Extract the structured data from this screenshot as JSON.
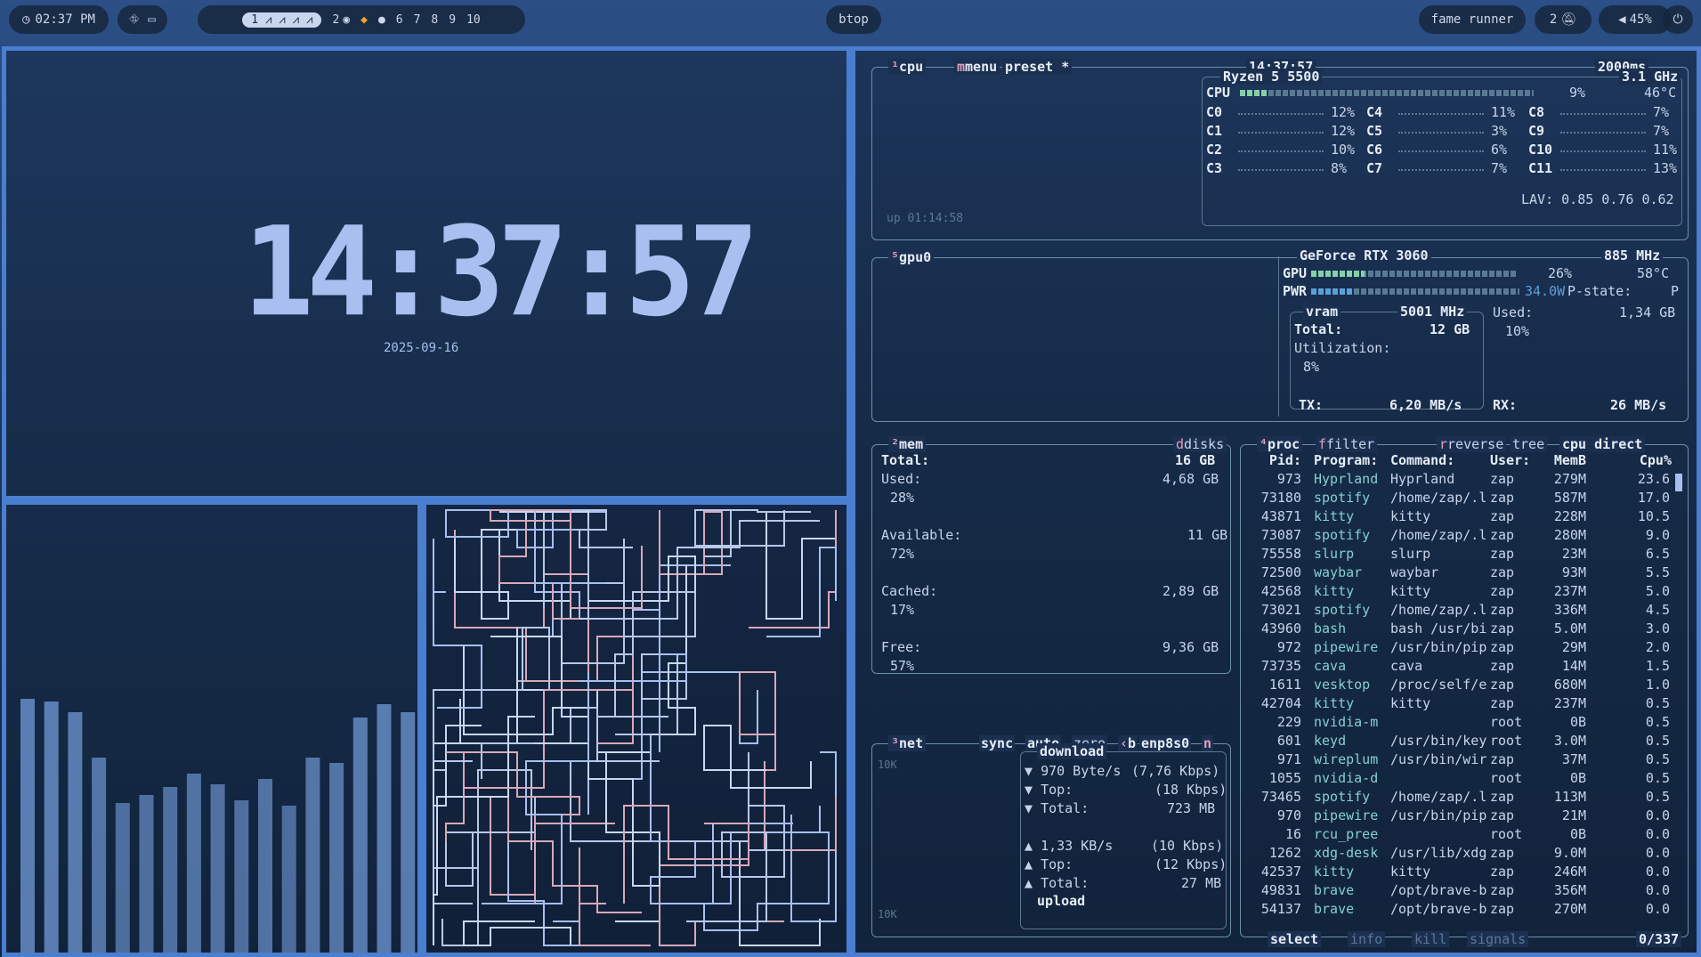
{
  "topbar": {
    "time": "02:37 PM",
    "workspaces_active": [
      "1"
    ],
    "workspaces": [
      "2",
      "6",
      "7",
      "8",
      "9",
      "10"
    ],
    "app_title": "btop",
    "music": "fame runner",
    "notifications": "2",
    "volume": "45%"
  },
  "clock": {
    "time": "14:37:57",
    "date": "2025-09-16"
  },
  "cpu": {
    "title": "cpu",
    "menu": "menu",
    "preset": "preset *",
    "time": "14:37:57",
    "interval": "2000ms",
    "model": "Ryzen 5 5500",
    "freq": "3.1 GHz",
    "total_label": "CPU",
    "total_pct": "9%",
    "temp": "46°C",
    "total_value": 0.09,
    "uptime": "up 01:14:58",
    "lav": "LAV: 0.85 0.76 0.62",
    "cores": [
      {
        "name": "C0",
        "pct": "12%"
      },
      {
        "name": "C1",
        "pct": "12%"
      },
      {
        "name": "C2",
        "pct": "10%"
      },
      {
        "name": "C3",
        "pct": "8%"
      },
      {
        "name": "C4",
        "pct": "11%"
      },
      {
        "name": "C5",
        "pct": "3%"
      },
      {
        "name": "C6",
        "pct": "6%"
      },
      {
        "name": "C7",
        "pct": "7%"
      },
      {
        "name": "C8",
        "pct": "7%"
      },
      {
        "name": "C9",
        "pct": "7%"
      },
      {
        "name": "C10",
        "pct": "11%"
      },
      {
        "name": "C11",
        "pct": "13%"
      }
    ]
  },
  "gpu": {
    "title": "gpu0",
    "model": "GeForce RTX 3060",
    "clock": "885 MHz",
    "gpu_label": "GPU",
    "gpu_pct": "26%",
    "gpu_temp": "58°C",
    "gpu_value": 0.26,
    "pwr_label": "PWR",
    "pwr": "34.0W",
    "pstate": "P-state:",
    "pstate_val": "P",
    "pwr_value": 0.2,
    "vram_label": "vram",
    "vram_clock": "5001 MHz",
    "total_label": "Total:",
    "total": "12 GB",
    "used_label": "Used:",
    "used": "1,34 GB",
    "used_pct": "10%",
    "util_label": "Utilization:",
    "util": "8%",
    "tx_label": "TX:",
    "tx": "6,20 MB/s",
    "rx_label": "RX:",
    "rx": "26 MB/s"
  },
  "mem": {
    "title": "mem",
    "disks": "disks",
    "total_label": "Total:",
    "total": "16 GB",
    "used_label": "Used:",
    "used": "4,68 GB",
    "used_pct": "28%",
    "avail_label": "Available:",
    "avail": "11 GB",
    "avail_pct": "72%",
    "cached_label": "Cached:",
    "cached": "2,89 GB",
    "cached_pct": "17%",
    "free_label": "Free:",
    "free": "9,36 GB",
    "free_pct": "57%"
  },
  "net": {
    "title": "net",
    "sync": "sync",
    "auto": "auto",
    "zero": "zero",
    "b": "b",
    "iface": "enp8s0",
    "n": "n",
    "scale_top": "10K",
    "scale_bottom": "10K",
    "download": "download",
    "upload": "upload",
    "dl_rate": "970 Byte/s",
    "dl_rate_k": "(7,76 Kbps)",
    "dl_top_label": "Top:",
    "dl_top": "(18 Kbps)",
    "dl_total_label": "Total:",
    "dl_total": "723 MB",
    "ul_rate": "1,33 KB/s",
    "ul_rate_k": "(10 Kbps)",
    "ul_top_label": "Top:",
    "ul_top": "(12 Kbps)",
    "ul_total_label": "Total:",
    "ul_total": "27 MB"
  },
  "proc": {
    "title": "proc",
    "filter": "filter",
    "reverse": "reverse",
    "tree": "tree",
    "sort": "cpu direct",
    "headers": {
      "pid": "Pid:",
      "program": "Program:",
      "command": "Command:",
      "user": "User:",
      "mem": "MemB",
      "cpu": "Cpu%"
    },
    "footer_select": "select",
    "footer_info": "info",
    "footer_kill": "kill",
    "footer_signals": "signals",
    "count": "0/337",
    "rows": [
      {
        "pid": "973",
        "program": "Hyprland",
        "command": "Hyprland",
        "user": "zap",
        "mem": "279M",
        "cpu": "23.6"
      },
      {
        "pid": "73180",
        "program": "spotify",
        "command": "/home/zap/.l",
        "user": "zap",
        "mem": "587M",
        "cpu": "17.0"
      },
      {
        "pid": "43871",
        "program": "kitty",
        "command": "kitty",
        "user": "zap",
        "mem": "228M",
        "cpu": "10.5"
      },
      {
        "pid": "73087",
        "program": "spotify",
        "command": "/home/zap/.l",
        "user": "zap",
        "mem": "280M",
        "cpu": "9.0"
      },
      {
        "pid": "75558",
        "program": "slurp",
        "command": "slurp",
        "user": "zap",
        "mem": "23M",
        "cpu": "6.5"
      },
      {
        "pid": "72500",
        "program": "waybar",
        "command": "waybar",
        "user": "zap",
        "mem": "93M",
        "cpu": "5.5"
      },
      {
        "pid": "42568",
        "program": "kitty",
        "command": "kitty",
        "user": "zap",
        "mem": "237M",
        "cpu": "5.0"
      },
      {
        "pid": "73021",
        "program": "spotify",
        "command": "/home/zap/.l",
        "user": "zap",
        "mem": "336M",
        "cpu": "4.5"
      },
      {
        "pid": "43960",
        "program": "bash",
        "command": "bash /usr/bi",
        "user": "zap",
        "mem": "5.0M",
        "cpu": "3.0"
      },
      {
        "pid": "972",
        "program": "pipewire",
        "command": "/usr/bin/pip",
        "user": "zap",
        "mem": "29M",
        "cpu": "2.0"
      },
      {
        "pid": "73735",
        "program": "cava",
        "command": "cava",
        "user": "zap",
        "mem": "14M",
        "cpu": "1.5"
      },
      {
        "pid": "1611",
        "program": "vesktop",
        "command": "/proc/self/e",
        "user": "zap",
        "mem": "680M",
        "cpu": "1.0"
      },
      {
        "pid": "42704",
        "program": "kitty",
        "command": "kitty",
        "user": "zap",
        "mem": "237M",
        "cpu": "0.5"
      },
      {
        "pid": "229",
        "program": "nvidia-m",
        "command": "",
        "user": "root",
        "mem": "0B",
        "cpu": "0.5"
      },
      {
        "pid": "601",
        "program": "keyd",
        "command": "/usr/bin/key",
        "user": "root",
        "mem": "3.0M",
        "cpu": "0.5"
      },
      {
        "pid": "971",
        "program": "wireplum",
        "command": "/usr/bin/wir",
        "user": "zap",
        "mem": "37M",
        "cpu": "0.5"
      },
      {
        "pid": "1055",
        "program": "nvidia-d",
        "command": "",
        "user": "root",
        "mem": "0B",
        "cpu": "0.5"
      },
      {
        "pid": "73465",
        "program": "spotify",
        "command": "/home/zap/.l",
        "user": "zap",
        "mem": "113M",
        "cpu": "0.5"
      },
      {
        "pid": "970",
        "program": "pipewire",
        "command": "/usr/bin/pip",
        "user": "zap",
        "mem": "21M",
        "cpu": "0.0"
      },
      {
        "pid": "16",
        "program": "rcu_pree",
        "command": "",
        "user": "root",
        "mem": "0B",
        "cpu": "0.0"
      },
      {
        "pid": "1262",
        "program": "xdg-desk",
        "command": "/usr/lib/xdg",
        "user": "zap",
        "mem": "9.0M",
        "cpu": "0.0"
      },
      {
        "pid": "42537",
        "program": "kitty",
        "command": "kitty",
        "user": "zap",
        "mem": "246M",
        "cpu": "0.0"
      },
      {
        "pid": "49831",
        "program": "brave",
        "command": "/opt/brave-b",
        "user": "zap",
        "mem": "356M",
        "cpu": "0.0"
      },
      {
        "pid": "54137",
        "program": "brave",
        "command": "/opt/brave-b",
        "user": "zap",
        "mem": "270M",
        "cpu": "0.0"
      }
    ]
  },
  "cava_levels": [
    0.95,
    0.94,
    0.9,
    0.73,
    0.56,
    0.59,
    0.62,
    0.67,
    0.63,
    0.57,
    0.65,
    0.55,
    0.73,
    0.71,
    0.88,
    0.93,
    0.9
  ],
  "colors": {
    "accent": "#4a7ed0",
    "border": "#6d8fa8",
    "meter": "#86d0a8",
    "clock": "#a8bff0"
  }
}
